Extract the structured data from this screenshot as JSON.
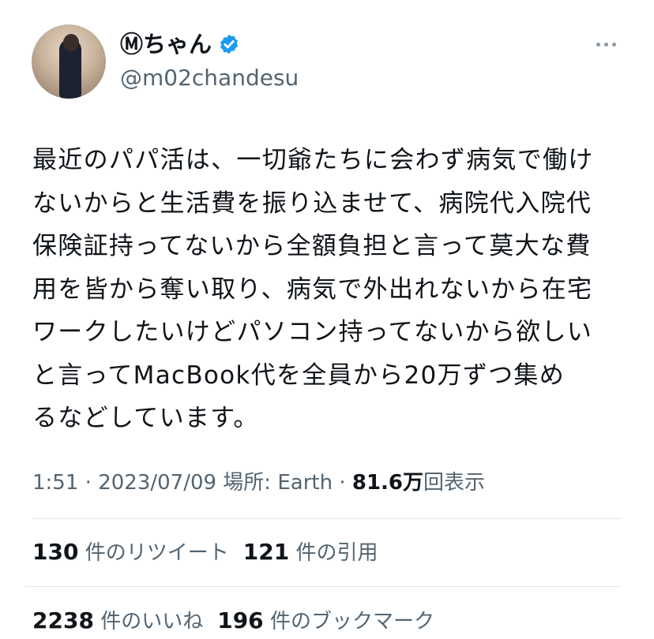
{
  "user": {
    "display_name": "Ⓜちゃん",
    "handle": "@m02chandesu",
    "verified": true
  },
  "tweet": {
    "text": "最近のパパ活は、一切爺たちに会わず病気で働け\nないからと生活費を振り込ませて、病院代入院代\n保険証持ってないから全額負担と言って莫大な費\n用を皆から奪い取り、病気で外出れないから在宅\nワークしたいけどパソコン持ってないから欲しい\nと言ってMacBook代を全員から20万ずつ集め\nるなどしています。"
  },
  "meta": {
    "time": "1:51",
    "sep1": " · ",
    "date": "2023/07/09",
    "location_label": " 場所: Earth",
    "sep2": " · ",
    "views_count": "81.6万",
    "views_label": "回表示"
  },
  "stats": {
    "retweets_count": "130",
    "retweets_label": "件のリツイート",
    "quotes_count": "121",
    "quotes_label": "件の引用",
    "likes_count": "2238",
    "likes_label": "件のいいね",
    "bookmarks_count": "196",
    "bookmarks_label": "件のブックマーク"
  },
  "icons": {
    "verified": "verified-badge-icon",
    "more": "more-options-icon"
  },
  "colors": {
    "verified": "#1d9bf0",
    "secondary_text": "#536471",
    "primary_text": "#0f1419",
    "divider": "#e1e6ea"
  }
}
